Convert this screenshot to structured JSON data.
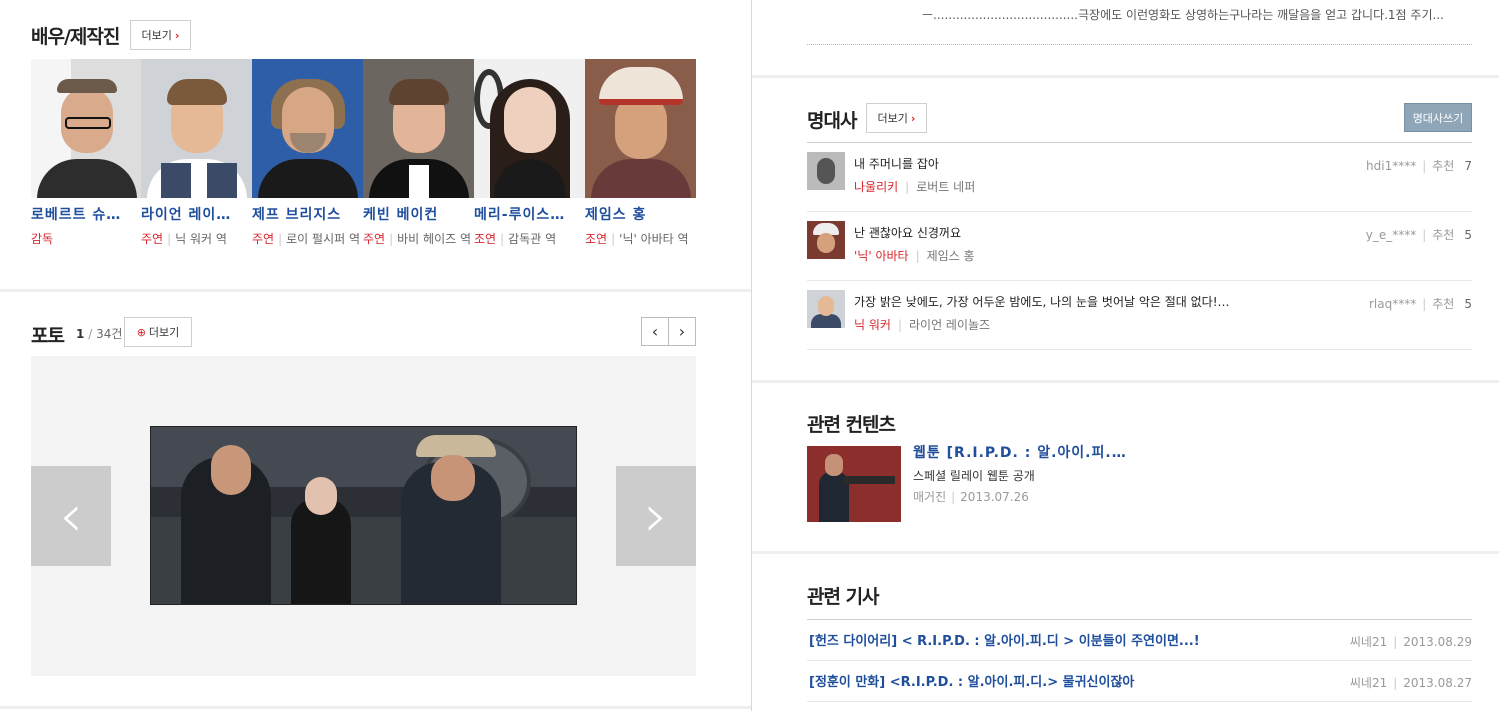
{
  "cast_section": {
    "title": "배우/제작진",
    "more_label": "더보기",
    "members": [
      {
        "name": "로베르트 슈…",
        "type": "감독",
        "role": ""
      },
      {
        "name": "라이언 레이…",
        "type": "주연",
        "role": "닉 워커 역"
      },
      {
        "name": "제프 브리지스",
        "type": "주연",
        "role": "로이 펄시퍼 역"
      },
      {
        "name": "케빈 베이컨",
        "type": "주연",
        "role": "바비 헤이즈 역"
      },
      {
        "name": "메리-루이스…",
        "type": "조연",
        "role": "감독관 역"
      },
      {
        "name": "제임스 홍",
        "type": "조연",
        "role": "'닉' 아바타 역"
      }
    ]
  },
  "photo_section": {
    "title": "포토",
    "current": "1",
    "total": "34건",
    "separator": "/",
    "more_label": "더보기"
  },
  "review_snippet": {
    "text": "ㅡ......................................극장에도 이런영화도 상영하는구나라는 깨달음을 얻고 갑니다.1점 주기..."
  },
  "quotes_section": {
    "title": "명대사",
    "more_label": "더보기",
    "write_label": "명대사쓰기",
    "recommend_label": "추천",
    "items": [
      {
        "quote": "내 주머니를 잡아",
        "character": "나울리키",
        "actor": "로버트 네퍼",
        "user": "hdi1****",
        "count": "7"
      },
      {
        "quote": "난 괜찮아요 신경꺼요",
        "character": "'닉' 아바타",
        "actor": "제임스 홍",
        "user": "y_e_****",
        "count": "5"
      },
      {
        "quote": "가장 밝은 낮에도, 가장 어두운 밤에도, 나의 눈을 벗어날 악은 절대 없다!…",
        "character": "닉 워커",
        "actor": "라이언 레이놀즈",
        "user": "rlaq****",
        "count": "5"
      }
    ]
  },
  "related_contents": {
    "title": "관련 컨텐츠",
    "item": {
      "title": "웹툰 [R.I.P.D. : 알.아이.피.…",
      "desc": "스페셜 릴레이 웹툰 공개",
      "source": "매거진",
      "date": "2013.07.26"
    }
  },
  "related_articles": {
    "title": "관련 기사",
    "items": [
      {
        "title": "[헌즈 다이어리] < R.I.P.D. : 알.아이.피.디 > 이분들이 주연이면...!",
        "source": "씨네21",
        "date": "2013.08.29"
      },
      {
        "title": "[정훈이 만화] <R.I.P.D. : 알.아이.피.디.> 물귀신이잖아",
        "source": "씨네21",
        "date": "2013.08.27"
      }
    ]
  },
  "colors": {
    "accent_red": "#d8262e",
    "link_blue": "#1f4e9c",
    "write_button": "#8fa6b8"
  }
}
